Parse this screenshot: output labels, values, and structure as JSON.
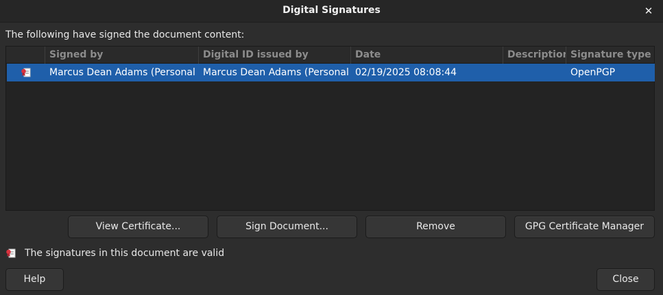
{
  "window": {
    "title": "Digital Signatures"
  },
  "intro_text": "The following have signed the document content:",
  "table": {
    "columns": [
      "Signed by",
      "Digital ID issued by",
      "Date",
      "Description",
      "Signature type"
    ],
    "rows": [
      {
        "icon": "signature-icon",
        "signed_by": "Marcus Dean Adams (Personal en",
        "issued_by": "Marcus Dean Adams (Personal er",
        "date": "02/19/2025 08:08:44",
        "description": "",
        "signature_type": "OpenPGP"
      }
    ]
  },
  "buttons": {
    "view_certificate": "View Certificate...",
    "sign_document": "Sign Document...",
    "remove": "Remove",
    "gpg_manager": "GPG Certificate Manager",
    "help": "Help",
    "close": "Close"
  },
  "status_text": "The signatures in this document are valid",
  "colors": {
    "selection": "#1f5faa",
    "icon_red": "#d9333f"
  }
}
